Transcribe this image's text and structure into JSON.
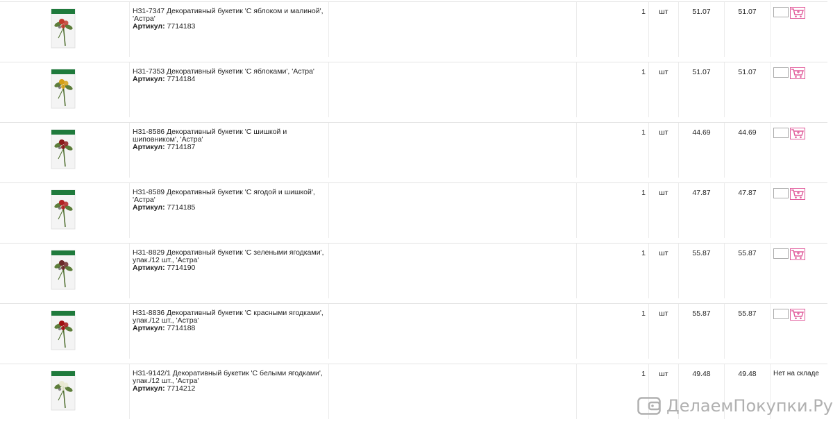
{
  "rows": [
    {
      "name": "Н31-7347 Декоративный букетик 'С яблоком и малиной', 'Астра'",
      "sku_label": "Артикул:",
      "sku": "7714183",
      "qty": "1",
      "unit": "шт",
      "price": "51.07",
      "sum": "51.07",
      "in_stock": true,
      "ribbon_color": "#1f7a3c",
      "accent_color": "#c0392b"
    },
    {
      "name": "Н31-7353 Декоративный букетик 'С яблоками', 'Астра'",
      "sku_label": "Артикул:",
      "sku": "7714184",
      "qty": "1",
      "unit": "шт",
      "price": "51.07",
      "sum": "51.07",
      "in_stock": true,
      "ribbon_color": "#1f7a3c",
      "accent_color": "#d4a017"
    },
    {
      "name": "Н31-8586 Декоративный букетик 'С шишкой и шиповником', 'Астра'",
      "sku_label": "Артикул:",
      "sku": "7714187",
      "qty": "1",
      "unit": "шт",
      "price": "44.69",
      "sum": "44.69",
      "in_stock": true,
      "ribbon_color": "#1f7a3c",
      "accent_color": "#8b1a1a"
    },
    {
      "name": "Н31-8589 Декоративный букетик 'С ягодой и шишкой', 'Астра'",
      "sku_label": "Артикул:",
      "sku": "7714185",
      "qty": "1",
      "unit": "шт",
      "price": "47.87",
      "sum": "47.87",
      "in_stock": true,
      "ribbon_color": "#1f7a3c",
      "accent_color": "#b22222"
    },
    {
      "name": "Н31-8829 Декоративный букетик 'С зелеными ягодками', упак./12 шт., 'Астра'",
      "sku_label": "Артикул:",
      "sku": "7714190",
      "qty": "1",
      "unit": "шт",
      "price": "55.87",
      "sum": "55.87",
      "in_stock": true,
      "ribbon_color": "#1f7a3c",
      "accent_color": "#6b2a2a"
    },
    {
      "name": "Н31-8836 Декоративный букетик 'С красными ягодками', упак./12 шт., 'Астра'",
      "sku_label": "Артикул:",
      "sku": "7714188",
      "qty": "1",
      "unit": "шт",
      "price": "55.87",
      "sum": "55.87",
      "in_stock": true,
      "ribbon_color": "#1f7a3c",
      "accent_color": "#a01010"
    },
    {
      "name": "Н31-9142/1 Декоративный букетик 'С белыми ягодками', упак./12 шт., 'Астра'",
      "sku_label": "Артикул:",
      "sku": "7714212",
      "qty": "1",
      "unit": "шт",
      "price": "49.48",
      "sum": "49.48",
      "in_stock": false,
      "out_of_stock_label": "Нет на складе",
      "ribbon_color": "#1f7a3c",
      "accent_color": "#e8e8d0"
    }
  ],
  "watermark": {
    "text": "ДелаемПокупки.Ру",
    "icon": "wallet-icon"
  },
  "colors": {
    "cart_icon": "#e05a9a",
    "grid_line": "#e4e4e4"
  }
}
